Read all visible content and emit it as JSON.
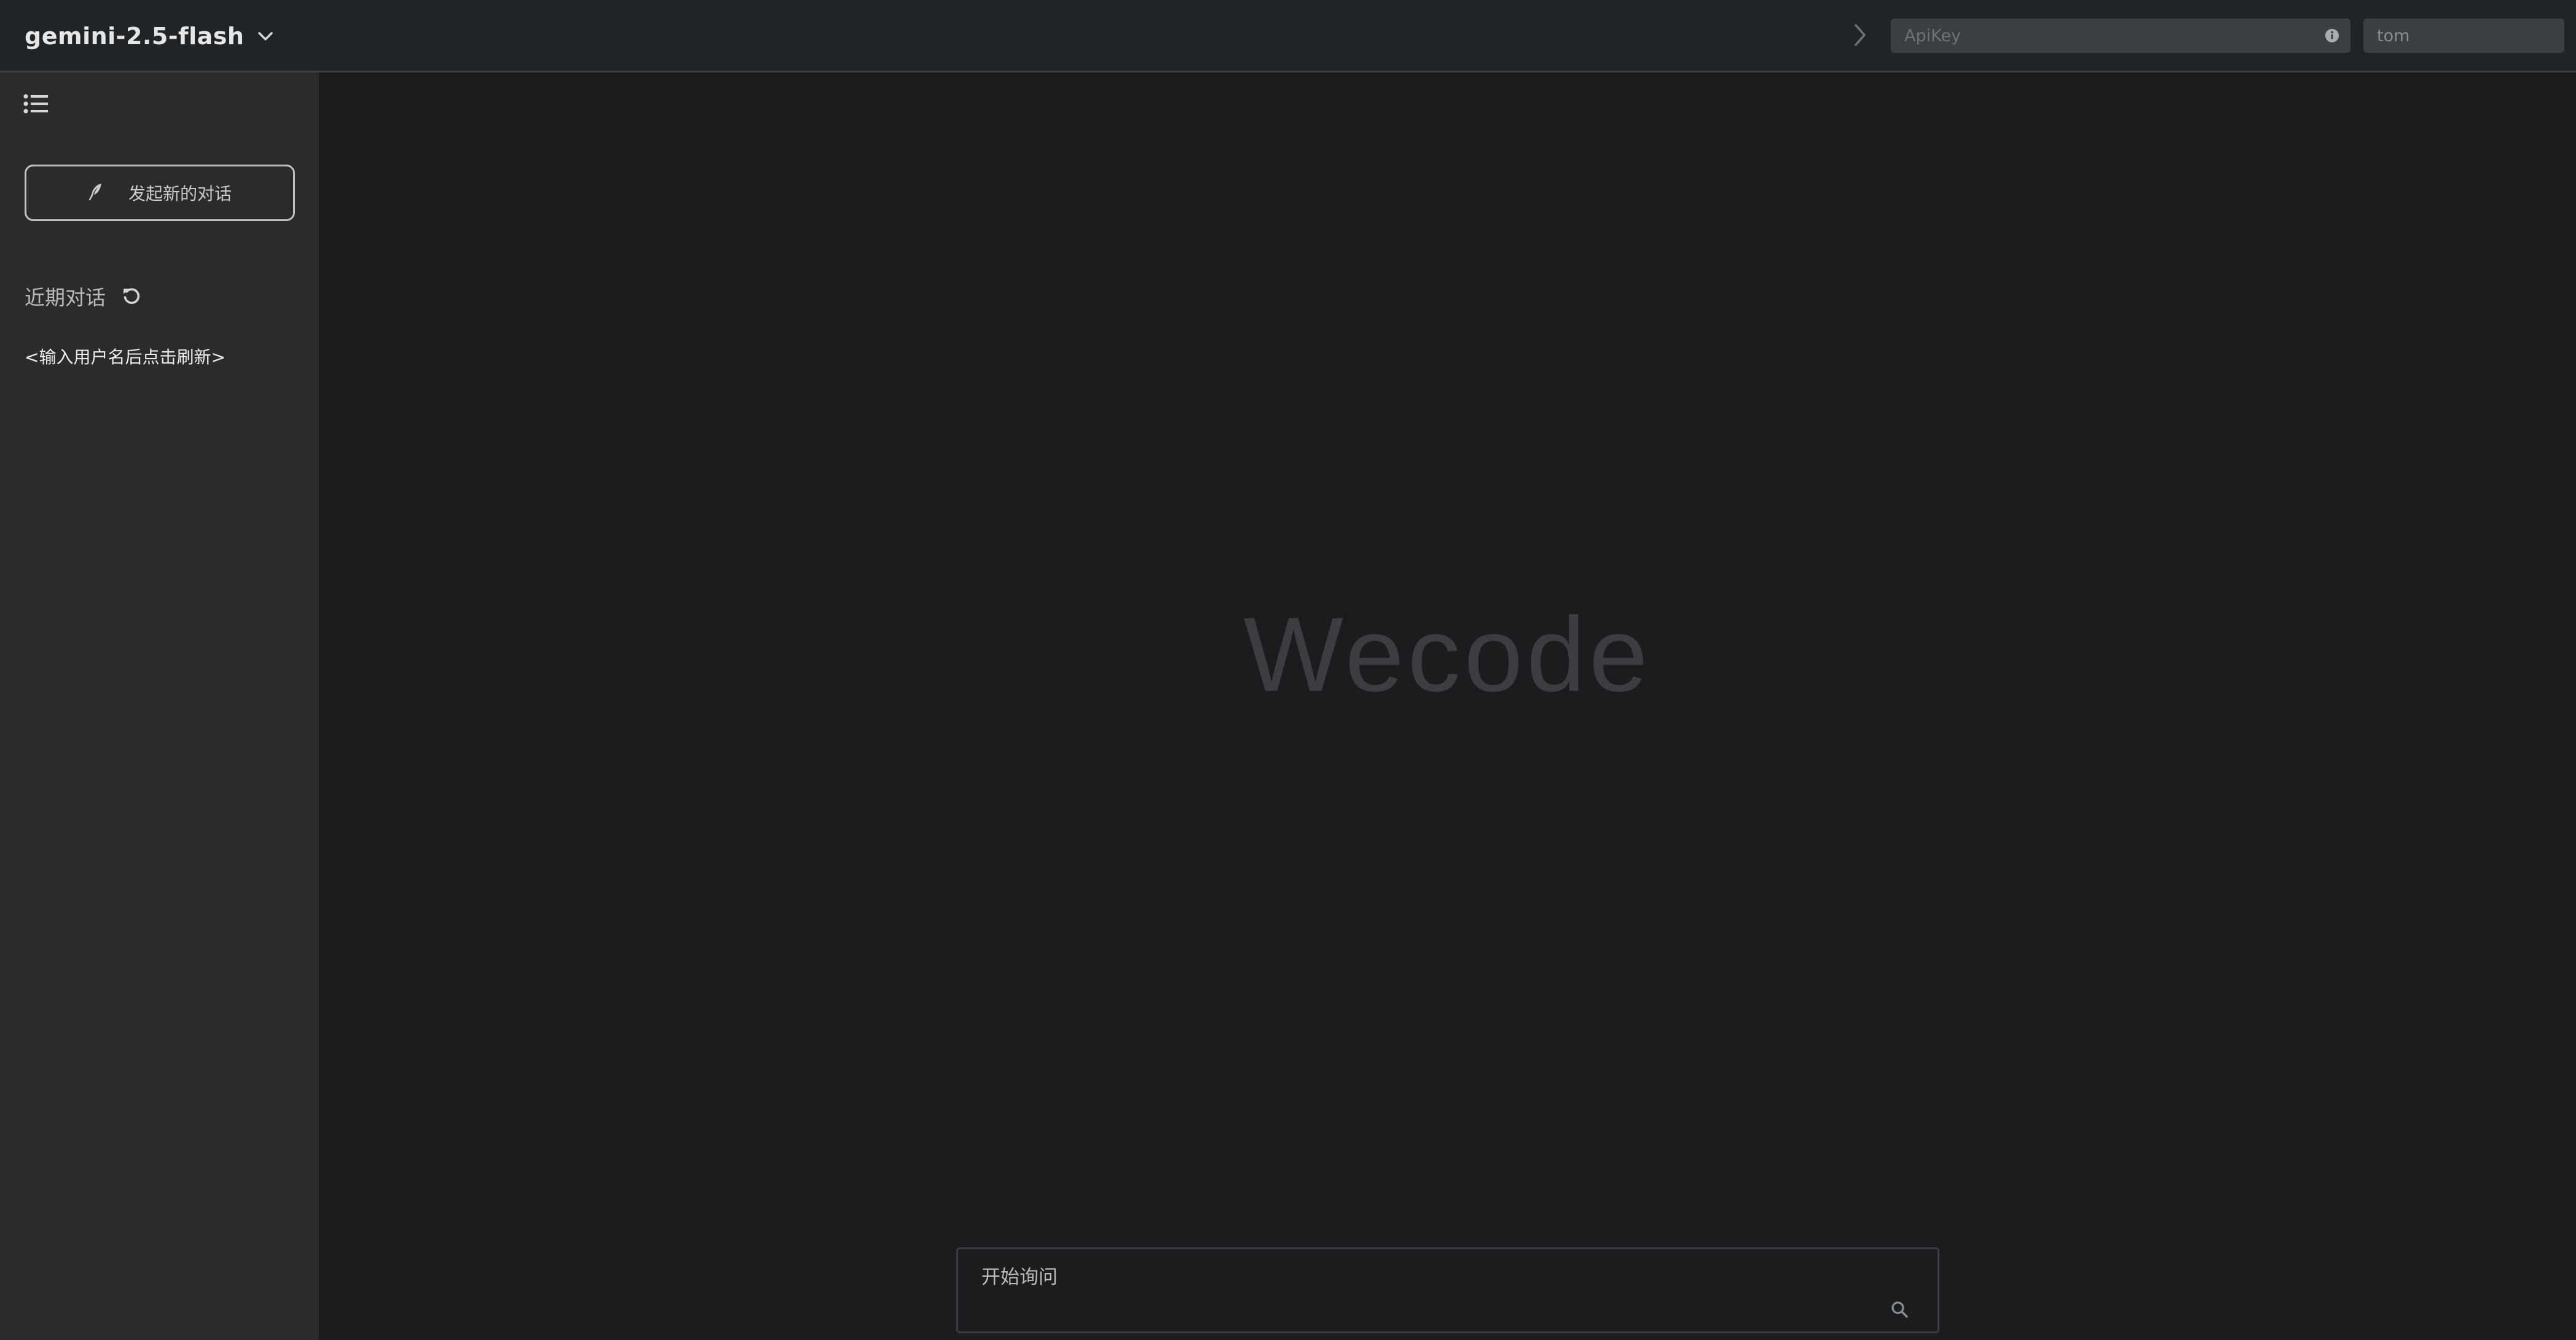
{
  "topbar": {
    "model_name": "gemini-2.5-flash",
    "model_icon": "chevron-down-icon",
    "collapse_icon": "chevron-right-icon",
    "apikey": {
      "placeholder": "ApiKey",
      "value": "",
      "icon": "info-icon"
    },
    "username": {
      "placeholder": "",
      "value": "tom",
      "icon": "info-icon"
    }
  },
  "sidebar": {
    "list_toggle_icon": "list-icon",
    "new_chat": {
      "label": "发起新的对话",
      "icon": "feather-icon"
    },
    "recent": {
      "title": "近期对话",
      "refresh_icon": "refresh-icon",
      "empty_hint": "<输入用户名后点击刷新>"
    }
  },
  "main": {
    "brand": "Wecode",
    "composer": {
      "placeholder": "开始询问",
      "value": "",
      "submit_icon": "search-icon"
    }
  },
  "colors": {
    "topbar_bg": "#212426",
    "sidebar_bg": "#2a2b2d",
    "main_bg": "#1b1c1e",
    "input_bg": "#3b3f42",
    "brand_text": "#3b3d40"
  }
}
